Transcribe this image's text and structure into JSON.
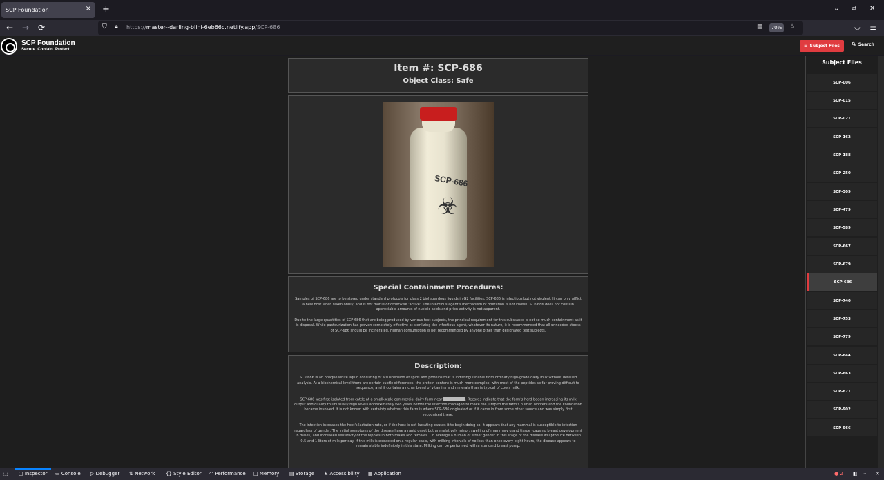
{
  "browser": {
    "tab_title": "SCP Foundation",
    "close_glyph": "×",
    "newtab_glyph": "+",
    "url_prefix": "https://",
    "url_host": "master--darling-blini-6eb66c.netlify.app",
    "url_path": "/SCP-686",
    "zoom": "70%",
    "back_glyph": "←",
    "forward_glyph": "→",
    "reload_glyph": "⟳",
    "menu_glyph": "≡",
    "minimize_glyph": "⌄",
    "restore_glyph": "⧉",
    "close_window_glyph": "✕"
  },
  "header": {
    "brand": "SCP Foundation",
    "tagline": "Secure. Contain. Protect.",
    "subject_files_button": "Subject Files",
    "search_button": "Search"
  },
  "item": {
    "title": "Item #: SCP-686",
    "object_class": "Object Class: Safe",
    "image_label": "SCP-686",
    "image_symbol": "☣"
  },
  "containment": {
    "heading": "Special Containment Procedures:",
    "paragraphs": [
      "Samples of SCP-686 are to be stored under standard protocols for class 2 biohazardous liquids in G2 facilities. SCP-686 is infectious but not virulent. It can only afflict a new host when taken orally, and is not motile or otherwise 'active'. The infectious agent's mechanism of operation is not known. SCP-686 does not contain appreciable amounts of nucleic acids and prion activity is not apparent.",
      "Due to the large quantities of SCP-686 that are being produced by various test subjects, the principal requirement for this substance is not so much containment as it is disposal. While pasteurization has proven completely effective at sterilizing the infectious agent, whatever its nature, it is recommended that all unneeded stocks of SCP-686 should be incinerated. Human consumption is not recommended by anyone other than designated test subjects."
    ]
  },
  "description": {
    "heading": "Description:",
    "p1": "SCP-686 is an opaque white liquid consisting of a suspension of lipids and proteins that is indistinguishable from ordinary high-grade dairy milk without detailed analysis. At a biochemical level there are certain subtle differences: the protein content is much more complex, with most of the peptides so far proving difficult to sequence, and it contains a richer blend of vitamins and minerals than is typical of cow's milk.",
    "p2_before": "SCP-686 was first isolated from cattle at a small-scale commercial dairy farm near",
    "p2_after": ". Records indicate that the farm's herd began increasing its milk output and quality to unusually high levels approximately two years before the infection managed to make the jump to the farm's human workers and the Foundation became involved. It is not known with certainty whether this farm is where SCP-686 originated or if it came in from some other source and was simply first recognized there.",
    "p3": "The infection increases the host's lactation rate, or if the host is not lactating causes it to begin doing so. It appears that any mammal is susceptible to infection regardless of gender. The initial symptoms of the disease have a rapid onset but are relatively minor: swelling of mammary gland tissue (causing breast development in males) and increased sensitivity of the nipples in both males and females. On average a human of either gender in this stage of the disease will produce between 0.5 and 1 liters of milk per day. If this milk is extracted on a regular basis, with milking intervals of no less than once every eight hours, the disease appears to remain stable indefinitely in this state. Milking can be performed with a standard breast pump."
  },
  "sidebar": {
    "title": "Subject Files",
    "items": [
      "SCP-006",
      "SCP-015",
      "SCP-021",
      "SCP-162",
      "SCP-188",
      "SCP-250",
      "SCP-309",
      "SCP-479",
      "SCP-589",
      "SCP-667",
      "SCP-679",
      "SCP-686",
      "SCP-740",
      "SCP-753",
      "SCP-779",
      "SCP-844",
      "SCP-863",
      "SCP-871",
      "SCP-902",
      "SCP-966"
    ],
    "active": "SCP-686"
  },
  "devtools": {
    "tabs": [
      "Inspector",
      "Console",
      "Debugger",
      "Network",
      "Style Editor",
      "Performance",
      "Memory",
      "Storage",
      "Accessibility",
      "Application"
    ],
    "error_count": "2"
  }
}
